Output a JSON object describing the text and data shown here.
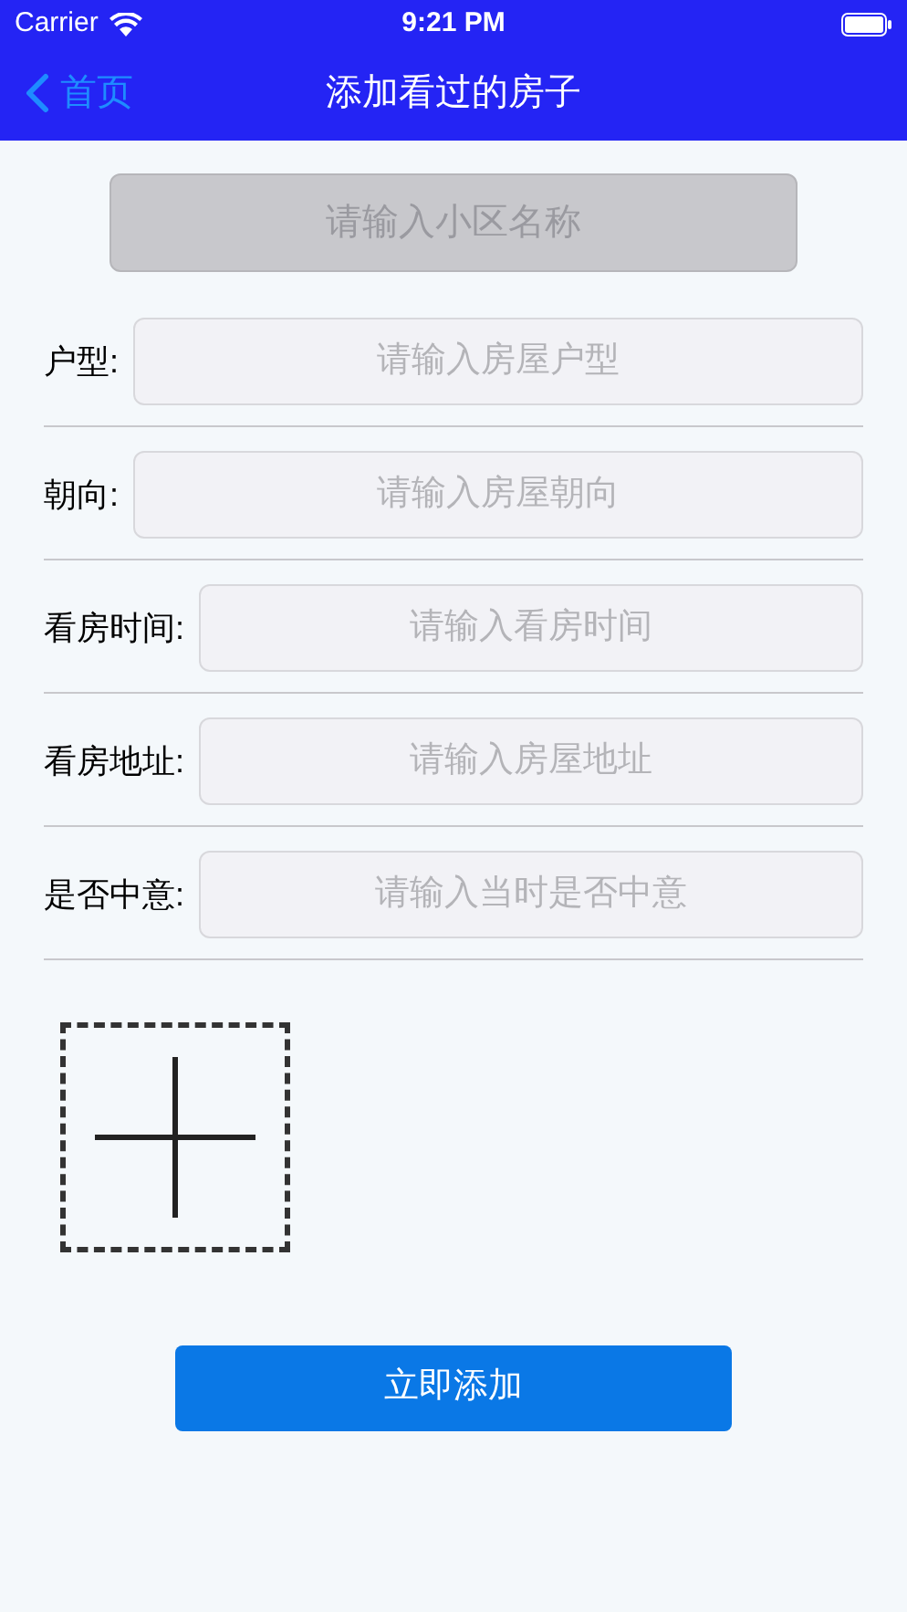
{
  "status_bar": {
    "carrier": "Carrier",
    "time": "9:21 PM"
  },
  "nav": {
    "back": "首页",
    "title": "添加看过的房子"
  },
  "community": {
    "placeholder": "请输入小区名称"
  },
  "fields": [
    {
      "label": "户型:",
      "placeholder": "请输入房屋户型"
    },
    {
      "label": "朝向:",
      "placeholder": "请输入房屋朝向"
    },
    {
      "label": "看房时间:",
      "placeholder": "请输入看房时间"
    },
    {
      "label": "看房地址:",
      "placeholder": "请输入房屋地址"
    },
    {
      "label": "是否中意:",
      "placeholder": "请输入当时是否中意"
    }
  ],
  "submit": "立即添加"
}
